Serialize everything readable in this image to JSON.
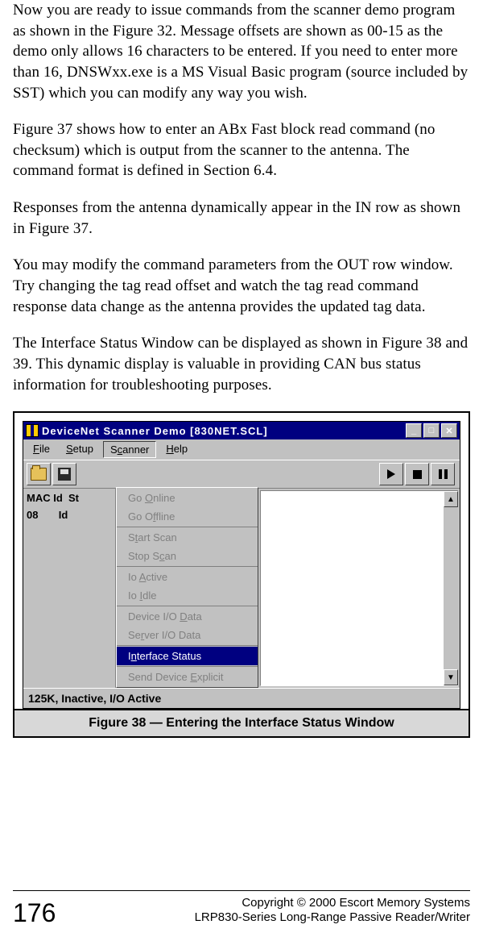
{
  "paragraphs": {
    "p1": "Now you are ready to issue commands from the scanner demo program as shown in the Figure 32.  Message offsets are shown as 00-15 as the demo only allows 16 characters to be entered.  If you need to enter more than 16, DNSWxx.exe is a MS Visual Basic program (source included by SST) which you can modify any way you wish.",
    "p2": "Figure 37 shows how to enter an ABx Fast block read command (no checksum) which is output from the scanner to the antenna.  The command format is defined in Section 6.4.",
    "p3": "Responses from the antenna dynamically appear in the IN row as shown in Figure 37.",
    "p4": "You may modify the command parameters from the OUT row window.  Try changing the tag read offset and watch the tag read command response data change as the antenna provides the updated tag data.",
    "p5": "The Interface Status Window can be displayed as shown in Figure  38 and 39. This dynamic display is valuable in providing CAN bus status information for troubleshooting purposes."
  },
  "window": {
    "title": "DeviceNet Scanner Demo [830NET.SCL]",
    "menubar": {
      "file": "File",
      "setup": "Setup",
      "scanner": "Scanner",
      "help": "Help"
    },
    "left": {
      "hdr_mac": "MAC Id",
      "hdr_st": "St",
      "val_mac": "08",
      "val_st": "Id"
    },
    "menu": {
      "go_online": "Go Online",
      "go_offline": "Go Offline",
      "start_scan": "Start Scan",
      "stop_scan": "Stop Scan",
      "io_active": "Io Active",
      "io_idle": "Io Idle",
      "device_io": "Device I/O Data",
      "server_io": "Server I/O Data",
      "interface_status": "Interface Status",
      "send_explicit": "Send Device Explicit"
    },
    "status": "125K, Inactive, I/O Active"
  },
  "caption": "Figure 38 — Entering the Interface Status Window",
  "footer": {
    "page": "176",
    "line1": "Copyright © 2000 Escort Memory Systems",
    "line2": "LRP830-Series Long-Range Passive Reader/Writer"
  }
}
